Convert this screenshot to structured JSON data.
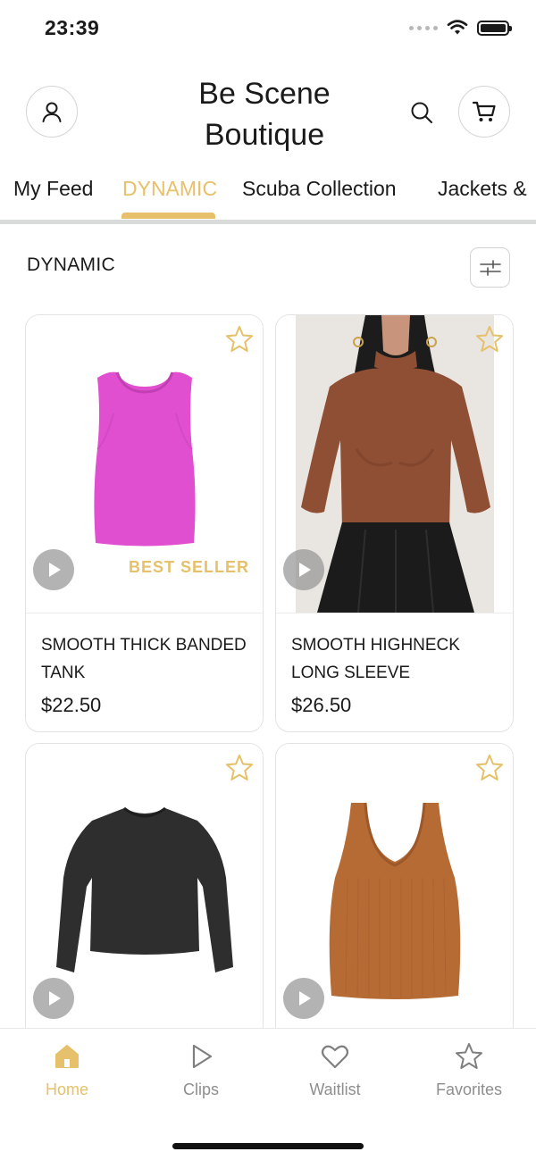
{
  "status_bar": {
    "time": "23:39"
  },
  "header": {
    "brand_line1": "Be Scene",
    "brand_line2": "Boutique"
  },
  "tabs": [
    {
      "label": "My Feed"
    },
    {
      "label": "DYNAMIC"
    },
    {
      "label": "Scuba Collection"
    },
    {
      "label": "Jackets &"
    }
  ],
  "active_tab": "DYNAMIC",
  "section": {
    "title": "DYNAMIC"
  },
  "products": [
    {
      "name": "SMOOTH THICK BANDED TANK",
      "price": "$22.50",
      "badge": "BEST SELLER",
      "color": "#e04fcf"
    },
    {
      "name": "SMOOTH HIGHNECK LONG SLEEVE",
      "price": "$26.50",
      "badge": "",
      "color": "#8f4f35"
    },
    {
      "name": "",
      "price": "",
      "badge": "",
      "color": "#2e2e2e"
    },
    {
      "name": "",
      "price": "",
      "badge": "",
      "color": "#b66b35"
    }
  ],
  "bottom_nav": [
    {
      "label": "Home"
    },
    {
      "label": "Clips"
    },
    {
      "label": "Waitlist"
    },
    {
      "label": "Favorites"
    }
  ],
  "colors": {
    "accent": "#e6c06a",
    "text": "#1a1a1a",
    "muted": "#8e8e8e",
    "border": "#e3e3e3"
  }
}
